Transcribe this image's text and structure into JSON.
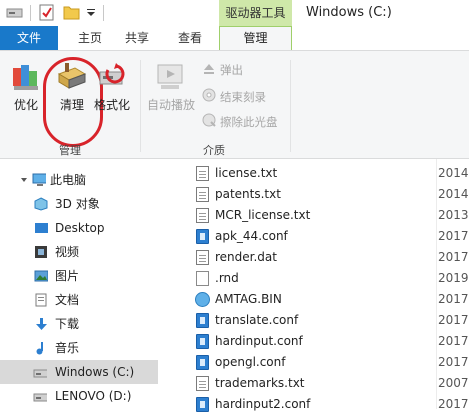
{
  "title_bar": {
    "drive_tools": "驱动器工具",
    "window_title": "Windows (C:)"
  },
  "tabs": {
    "file": "文件",
    "home": "主页",
    "share": "共享",
    "view": "查看",
    "manage": "管理"
  },
  "ribbon": {
    "manage_group": {
      "label": "管理",
      "optimize": "优化",
      "cleanup": "清理",
      "format": "格式化"
    },
    "media_group": {
      "label": "介质",
      "autoplay": "自动播放",
      "eject": "弹出",
      "finish_burn": "结束刻录",
      "erase_disc": "擦除此光盘"
    }
  },
  "nav": {
    "items": [
      {
        "label": "此电脑",
        "icon": "computer-icon"
      },
      {
        "label": "3D 对象",
        "icon": "3d-objects-icon"
      },
      {
        "label": "Desktop",
        "icon": "desktop-icon"
      },
      {
        "label": "视频",
        "icon": "video-icon"
      },
      {
        "label": "图片",
        "icon": "pictures-icon"
      },
      {
        "label": "文档",
        "icon": "documents-icon"
      },
      {
        "label": "下载",
        "icon": "download-icon"
      },
      {
        "label": "音乐",
        "icon": "music-icon"
      },
      {
        "label": "Windows (C:)",
        "icon": "drive-icon"
      },
      {
        "label": "LENOVO (D:)",
        "icon": "drive-icon"
      }
    ]
  },
  "files": [
    {
      "name": "license.txt",
      "date": "2014,",
      "icon": "text-file-icon"
    },
    {
      "name": "patents.txt",
      "date": "2014,",
      "icon": "text-file-icon"
    },
    {
      "name": "MCR_license.txt",
      "date": "2013,",
      "icon": "text-file-icon"
    },
    {
      "name": "apk_44.conf",
      "date": "2017,",
      "icon": "conf-file-icon"
    },
    {
      "name": "render.dat",
      "date": "2017,",
      "icon": "text-file-icon"
    },
    {
      "name": ".rnd",
      "date": "2019,",
      "icon": "blank-file-icon"
    },
    {
      "name": "AMTAG.BIN",
      "date": "2017,",
      "icon": "bin-file-icon"
    },
    {
      "name": "translate.conf",
      "date": "2017,",
      "icon": "conf-file-icon"
    },
    {
      "name": "hardinput.conf",
      "date": "2017,",
      "icon": "conf-file-icon"
    },
    {
      "name": "opengl.conf",
      "date": "2017,",
      "icon": "conf-file-icon"
    },
    {
      "name": "trademarks.txt",
      "date": "2007,",
      "icon": "text-file-icon"
    },
    {
      "name": "hardinput2.conf",
      "date": "2017,",
      "icon": "conf-file-icon"
    }
  ],
  "colors": {
    "accent_blue": "#1979ca",
    "drive_tools_green": "#cfe8a9",
    "annotation_red": "#d8232a"
  }
}
